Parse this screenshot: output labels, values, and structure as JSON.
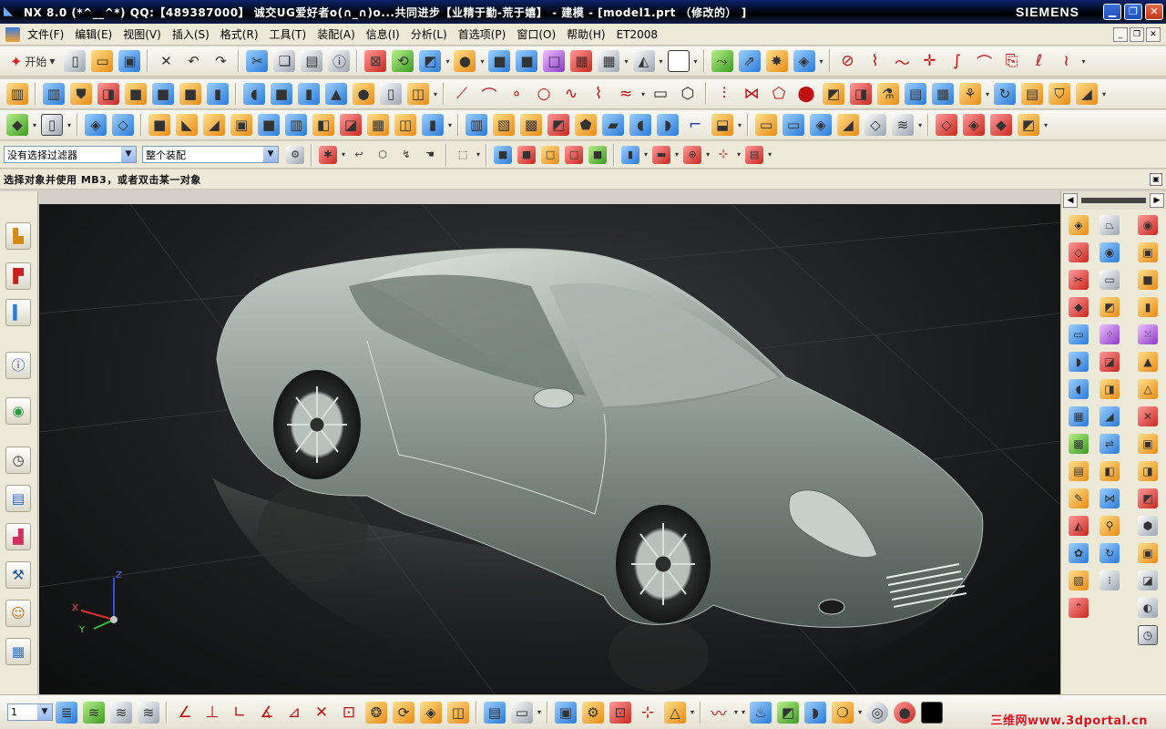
{
  "window": {
    "title": "NX 8.0 (*^__^*) QQ:【489387000】 诚交UG爱好者o(∩_∩)o...共同进步【业精于勤-荒于嬉】 - 建模 - [model1.prt （修改的） ]",
    "brand": "SIEMENS"
  },
  "menu": {
    "items": [
      "文件(F)",
      "编辑(E)",
      "视图(V)",
      "插入(S)",
      "格式(R)",
      "工具(T)",
      "装配(A)",
      "信息(I)",
      "分析(L)",
      "首选项(P)",
      "窗口(O)",
      "帮助(H)",
      "ET2008"
    ]
  },
  "toolbar": {
    "start_label": "开始",
    "start_arrow": "▾"
  },
  "filter": {
    "selection_filter": "没有选择过滤器",
    "scope": "整个装配"
  },
  "cue": {
    "text": "选择对象并使用 MB3，或者双击某一对象"
  },
  "viewport": {
    "axis_labels": {
      "x": "X",
      "y": "Y",
      "z": "Z"
    }
  },
  "bottom": {
    "layer_value": "1"
  },
  "watermark": "三维网www.3dportal.cn",
  "colors": {
    "title_bg": "#0a246a",
    "viewport_bg": "#1c1e1f",
    "car_body": "#8a9690"
  }
}
